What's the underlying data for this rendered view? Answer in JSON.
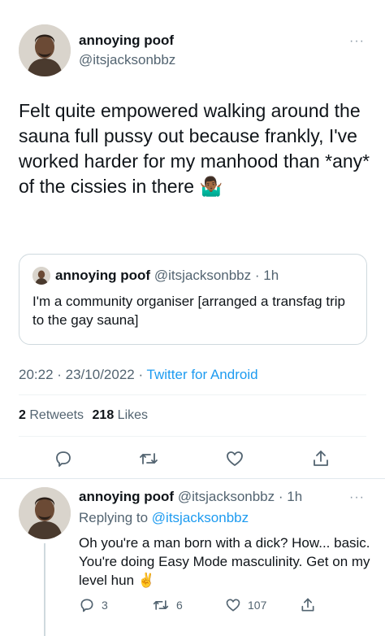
{
  "main_tweet": {
    "display_name": "annoying poof",
    "handle": "@itsjacksonbbz",
    "more": "···",
    "text": "Felt quite empowered walking around the sauna full pussy out because frankly, I've worked harder for my manhood than *any* of the cissies in there",
    "emoji": "🤷🏾‍♂️",
    "quote": {
      "display_name": "annoying poof",
      "handle": "@itsjacksonbbz",
      "time": "· 1h",
      "text": "I'm a community organiser [arranged a transfag trip to the gay sauna]"
    },
    "timestamp": "20:22 · 23/10/2022 ·",
    "source": "Twitter for Android",
    "retweets_count": "2",
    "retweets_label": "Retweets",
    "likes_count": "218",
    "likes_label": "Likes"
  },
  "reply": {
    "display_name": "annoying poof",
    "handle": "@itsjacksonbbz",
    "time": "· 1h",
    "more": "···",
    "replying_to_label": "Replying to",
    "replying_to_handle": "@itsjacksonbbz",
    "text": "Oh you're a man born with a dick? How... basic. You're doing Easy Mode masculinity. Get on my level hun",
    "emoji": "✌️",
    "reply_count": "3",
    "retweet_count": "6",
    "like_count": "107"
  }
}
